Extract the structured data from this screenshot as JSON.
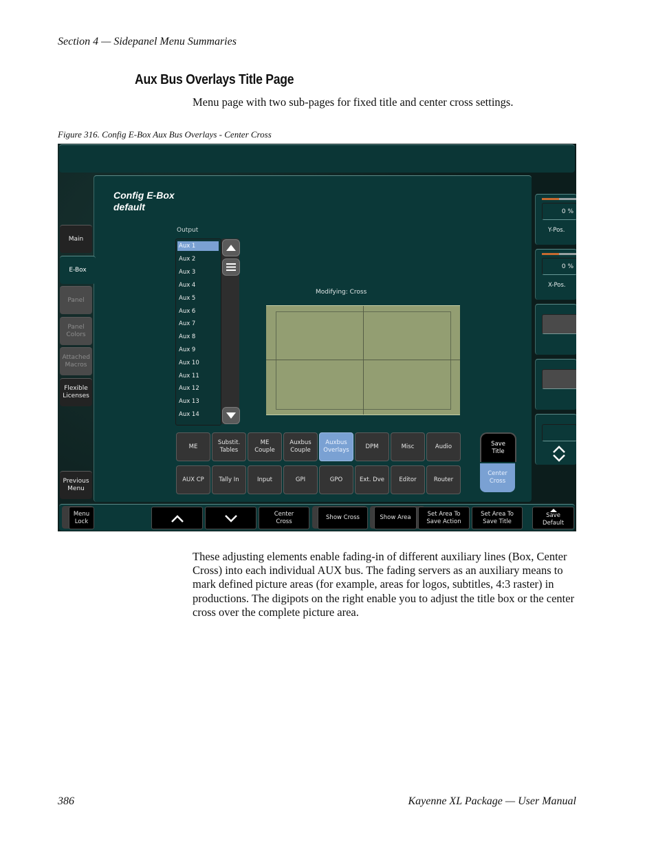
{
  "page": {
    "header": "Section 4 — Sidepanel Menu Summaries",
    "heading": "Aux Bus Overlays Title Page",
    "intro": "Menu page with two sub-pages for fixed title and center cross settings.",
    "figure_caption": "Figure 316.  Config E-Box Aux Bus Overlays - Center Cross",
    "body_paragraph": "These adjusting elements enable fading-in of different auxiliary lines (Box, Center Cross) into each individual AUX bus. The fading servers as an auxiliary means to mark defined picture areas (for example, areas for logos, subtitles, 4:3 raster) in productions. The digipots on the right enable you to adjust the title box or the center cross over the complete picture area.",
    "footer_page_number": "386",
    "footer_title": "Kayenne XL Package  —  User Manual"
  },
  "ui": {
    "panel_title_line1": "Config E-Box",
    "panel_title_line2": "default",
    "sidebar": [
      {
        "label": "Main",
        "state": "dark"
      },
      {
        "label": "E-Box",
        "state": "active"
      },
      {
        "label": "Panel",
        "state": "disabled"
      },
      {
        "label": "Panel Colors",
        "state": "disabled"
      },
      {
        "label": "Attached Macros",
        "state": "disabled"
      },
      {
        "label": "Flexible Licenses",
        "state": "dark"
      },
      {
        "label": "Previous Menu",
        "state": "dark"
      }
    ],
    "output_label": "Output",
    "output_list": [
      "Aux 1",
      "Aux 2",
      "Aux 3",
      "Aux 4",
      "Aux 5",
      "Aux 6",
      "Aux 7",
      "Aux 8",
      "Aux 9",
      "Aux 10",
      "Aux 11",
      "Aux 12",
      "Aux 13",
      "Aux 14"
    ],
    "selected_output": "Aux 1",
    "modifying_label": "Modifying: Cross",
    "category_buttons_row1": [
      "ME",
      "Substit. Tables",
      "ME Couple",
      "Auxbus Couple",
      "Auxbus Overlays",
      "DPM",
      "Misc",
      "Audio"
    ],
    "category_buttons_row2": [
      "AUX CP",
      "Tally In",
      "Input",
      "GPI",
      "GPO",
      "Ext. Dve",
      "Editor",
      "Router"
    ],
    "active_category": "Auxbus Overlays",
    "save_title_label": "Save Title",
    "center_cross_label": "Center Cross",
    "digipots": [
      {
        "label": "Y-Pos.",
        "value": "0 %",
        "level_fraction": 0.5
      },
      {
        "label": "X-Pos.",
        "value": "0 %",
        "level_fraction": 0.5
      }
    ],
    "bottom_bar": {
      "menu_lock": "Menu Lock",
      "up_icon": "chevron-up",
      "down_icon": "chevron-down",
      "center_cross": "Center Cross",
      "show_cross": "Show Cross",
      "show_area": "Show Area",
      "set_area_action": "Set Area To Save Action",
      "set_area_title": "Set Area To Save Title",
      "save_default": "Save Default"
    }
  }
}
